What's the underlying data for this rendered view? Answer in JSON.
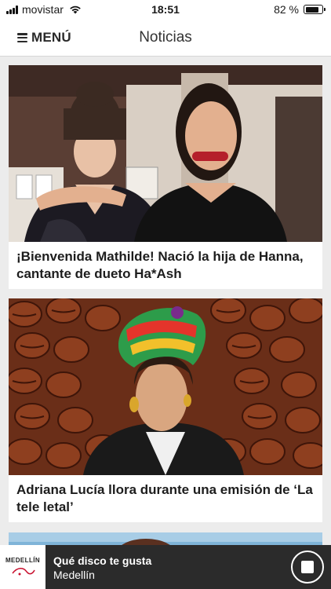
{
  "status_bar": {
    "carrier": "movistar",
    "time": "18:51",
    "battery_percent": "82 %",
    "battery_level": 0.82,
    "icons": [
      "signal-icon",
      "wifi-icon",
      "battery-icon"
    ]
  },
  "header": {
    "menu_label": "MENÚ",
    "title": "Noticias"
  },
  "feed": {
    "articles": [
      {
        "title": "¡Bienvenida Mathilde! Nació la hija de Hanna, cantante de dueto Ha*Ash"
      },
      {
        "title": "Adriana Lucía llora durante una emisión de ‘La tele letal’"
      }
    ]
  },
  "player": {
    "station_logo": "MEDELLÍN",
    "track_title": "Qué disco te gusta",
    "station_name": "Medellín",
    "stop_icon": "stop-icon"
  },
  "colors": {
    "background": "#ececec",
    "player_bg": "#2b2b2b",
    "text": "#1d1d1d"
  }
}
